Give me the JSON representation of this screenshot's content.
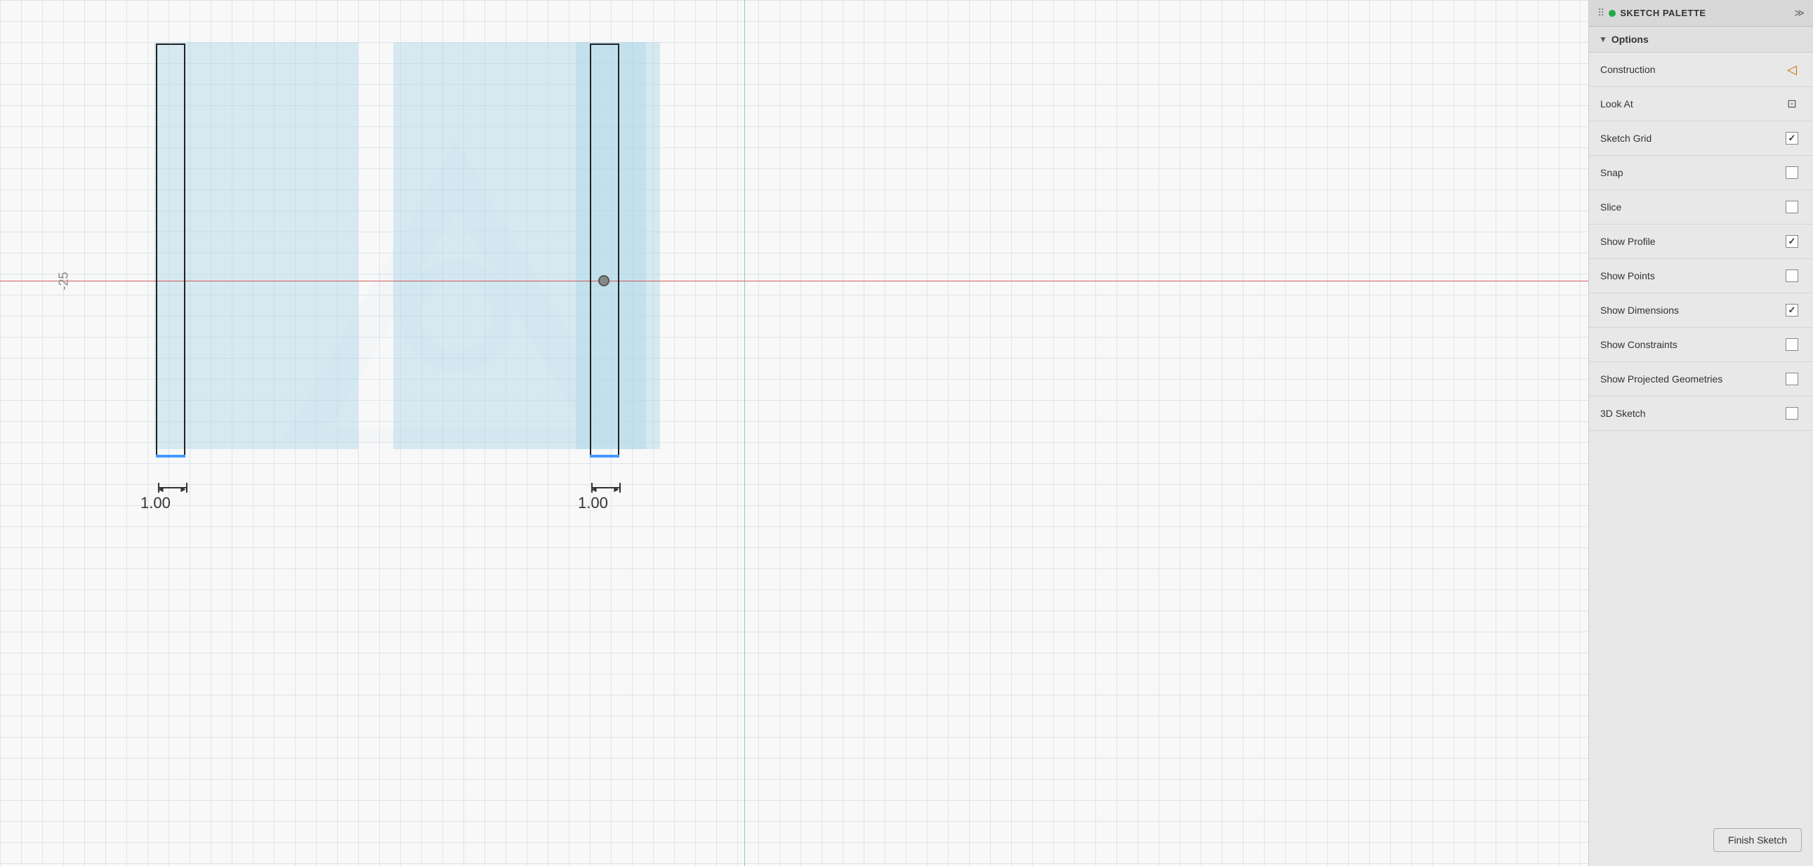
{
  "panel": {
    "title": "SKETCH PALETTE",
    "dot_color": "#22aa44",
    "sections": {
      "options": {
        "label": "Options",
        "items": [
          {
            "id": "construction",
            "label": "Construction",
            "control": "icon",
            "icon": "construction-icon",
            "checked": false
          },
          {
            "id": "look-at",
            "label": "Look At",
            "control": "icon",
            "icon": "lookat-icon",
            "checked": false
          },
          {
            "id": "sketch-grid",
            "label": "Sketch Grid",
            "control": "checkbox",
            "checked": true
          },
          {
            "id": "snap",
            "label": "Snap",
            "control": "checkbox",
            "checked": false
          },
          {
            "id": "slice",
            "label": "Slice",
            "control": "checkbox",
            "checked": false
          },
          {
            "id": "show-profile",
            "label": "Show Profile",
            "control": "checkbox",
            "checked": true
          },
          {
            "id": "show-points",
            "label": "Show Points",
            "control": "checkbox",
            "checked": false
          },
          {
            "id": "show-dimensions",
            "label": "Show Dimensions",
            "control": "checkbox",
            "checked": true
          },
          {
            "id": "show-constraints",
            "label": "Show Constraints",
            "control": "checkbox",
            "checked": false
          },
          {
            "id": "show-projected",
            "label": "Show Projected Geometries",
            "control": "checkbox",
            "checked": false
          },
          {
            "id": "3d-sketch",
            "label": "3D Sketch",
            "control": "checkbox",
            "checked": false
          }
        ]
      }
    },
    "finish_sketch_label": "Finish Sketch"
  },
  "canvas": {
    "axis_label": "-25",
    "dim1_value": "1.00",
    "dim2_value": "1.00"
  }
}
